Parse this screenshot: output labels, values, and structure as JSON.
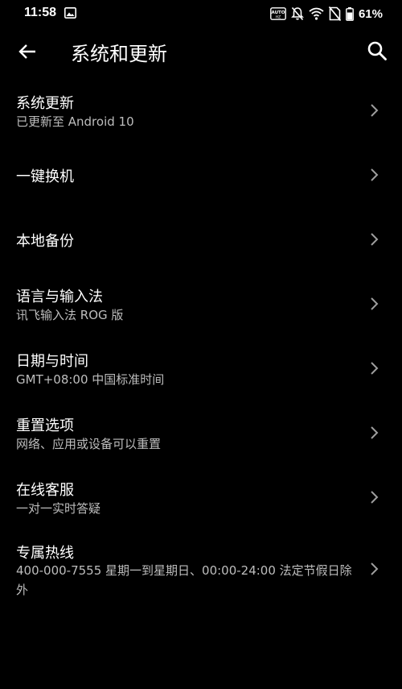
{
  "status_bar": {
    "time": "11:58",
    "battery_percent": "61%",
    "icons": [
      "gallery-icon",
      "auto-icon",
      "notifications-off-icon",
      "wifi-icon",
      "no-sim-icon",
      "battery-icon"
    ]
  },
  "header": {
    "title": "系统和更新",
    "back_icon": "arrow-left-icon",
    "search_icon": "search-icon"
  },
  "items": [
    {
      "title": "系统更新",
      "subtitle": "已更新至 Android 10"
    },
    {
      "title": "一键换机",
      "subtitle": ""
    },
    {
      "title": "本地备份",
      "subtitle": ""
    },
    {
      "title": "语言与输入法",
      "subtitle": "讯飞输入法 ROG 版"
    },
    {
      "title": "日期与时间",
      "subtitle": "GMT+08:00 中国标准时间"
    },
    {
      "title": "重置选项",
      "subtitle": "网络、应用或设备可以重置"
    },
    {
      "title": "在线客服",
      "subtitle": "一对一实时答疑"
    },
    {
      "title": "专属热线",
      "subtitle": "400-000-7555 星期一到星期日、00:00-24:00 法定节假日除外"
    }
  ],
  "colors": {
    "background": "#000000",
    "text_primary": "#ffffff",
    "text_secondary": "#bdbdbd",
    "chevron": "#9e9e9e"
  }
}
